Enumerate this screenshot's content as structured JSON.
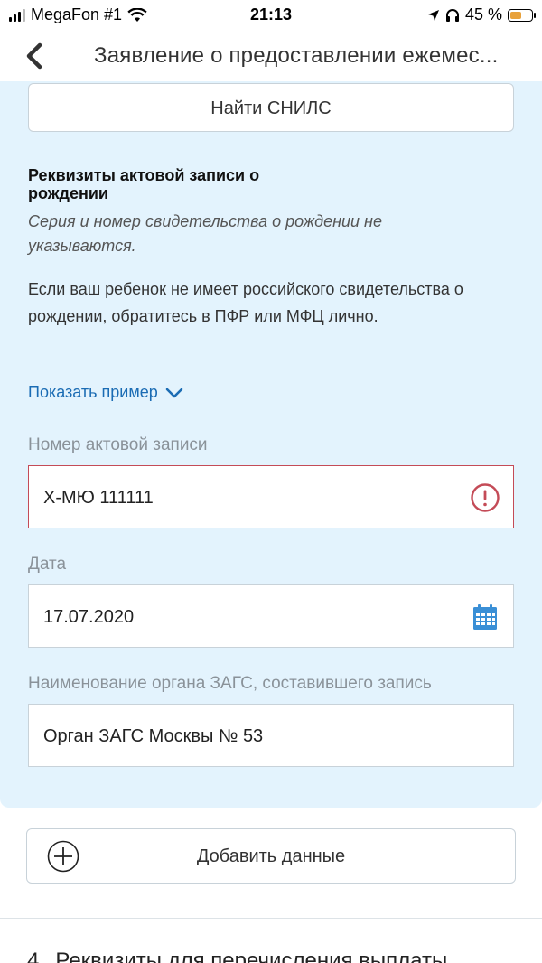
{
  "status": {
    "carrier": "MegaFon #1",
    "time": "21:13",
    "battery": "45 %"
  },
  "nav": {
    "title": "Заявление о предоставлении ежемес..."
  },
  "find_snils_label": "Найти СНИЛС",
  "record_section": {
    "title": "Реквизиты актовой записи о рождении",
    "note": "Серия и номер свидетельства о рождении не указываются.",
    "info": "Если ваш ребенок не имеет российского свидетельства о рождении, обратитесь в ПФР или МФЦ лично.",
    "example_link": "Показать пример"
  },
  "fields": {
    "record_number": {
      "label": "Номер актовой записи",
      "value": "Х-МЮ 111111"
    },
    "date": {
      "label": "Дата",
      "value": "17.07.2020"
    },
    "registry_office": {
      "label": "Наименование органа ЗАГС, составившего запись",
      "value": "Орган ЗАГС Москвы № 53"
    }
  },
  "add_data_label": "Добавить данные",
  "next_section": {
    "number": "4",
    "title": "Реквизиты для перечисления выплаты"
  },
  "colors": {
    "panel_bg": "#e3f3fd",
    "link": "#1b6cb4",
    "error": "#c44b57",
    "calendar": "#3a8fd6"
  }
}
